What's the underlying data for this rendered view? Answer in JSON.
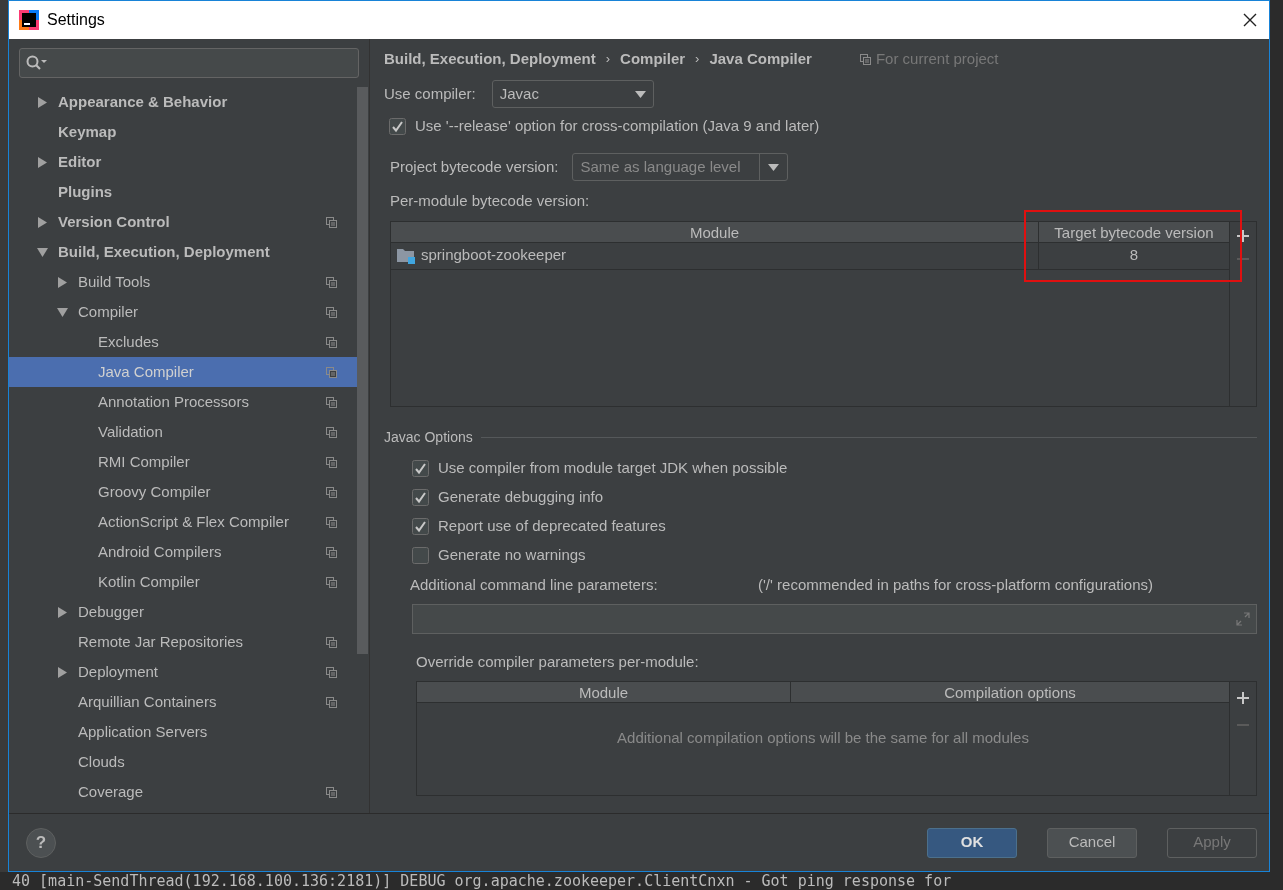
{
  "window": {
    "title": "Settings"
  },
  "sidebar": {
    "items": [
      {
        "label": "Appearance & Behavior",
        "expanded": false,
        "project_level": false,
        "selected": false
      },
      {
        "label": "Keymap",
        "project_level": false,
        "selected": false
      },
      {
        "label": "Editor",
        "expanded": false,
        "project_level": false,
        "selected": false
      },
      {
        "label": "Plugins",
        "project_level": false,
        "selected": false
      },
      {
        "label": "Version Control",
        "expanded": false,
        "project_level": true,
        "selected": false
      },
      {
        "label": "Build, Execution, Deployment",
        "expanded": true,
        "project_level": false,
        "selected": false,
        "children": [
          {
            "label": "Build Tools",
            "expanded": false,
            "project_level": true,
            "selected": false
          },
          {
            "label": "Compiler",
            "expanded": true,
            "project_level": true,
            "selected": false,
            "children": [
              {
                "label": "Excludes",
                "project_level": true,
                "selected": false
              },
              {
                "label": "Java Compiler",
                "project_level": true,
                "selected": true
              },
              {
                "label": "Annotation Processors",
                "project_level": true,
                "selected": false
              },
              {
                "label": "Validation",
                "project_level": true,
                "selected": false
              },
              {
                "label": "RMI Compiler",
                "project_level": true,
                "selected": false
              },
              {
                "label": "Groovy Compiler",
                "project_level": true,
                "selected": false
              },
              {
                "label": "ActionScript & Flex Compiler",
                "project_level": true,
                "selected": false
              },
              {
                "label": "Android Compilers",
                "project_level": true,
                "selected": false
              },
              {
                "label": "Kotlin Compiler",
                "project_level": true,
                "selected": false
              }
            ]
          },
          {
            "label": "Debugger",
            "expanded": false,
            "project_level": false,
            "selected": false
          },
          {
            "label": "Remote Jar Repositories",
            "project_level": true,
            "selected": false
          },
          {
            "label": "Deployment",
            "expanded": false,
            "project_level": true,
            "selected": false
          },
          {
            "label": "Arquillian Containers",
            "project_level": true,
            "selected": false
          },
          {
            "label": "Application Servers",
            "project_level": false,
            "selected": false
          },
          {
            "label": "Clouds",
            "project_level": false,
            "selected": false
          },
          {
            "label": "Coverage",
            "project_level": true,
            "selected": false
          }
        ]
      }
    ]
  },
  "breadcrumb": [
    "Build, Execution, Deployment",
    "Compiler",
    "Java Compiler"
  ],
  "breadcrumb_separator": "›",
  "scope_note": "For current project",
  "use_compiler": {
    "label": "Use compiler:",
    "value": "Javac"
  },
  "release_option": {
    "label": "Use '--release' option for cross-compilation (Java 9 and later)",
    "checked": true
  },
  "project_bytecode": {
    "label": "Project bytecode version:",
    "value": "Same as language level",
    "disabled": true
  },
  "per_module": {
    "label": "Per-module bytecode version:",
    "columns": [
      "Module",
      "Target bytecode version"
    ],
    "rows": [
      {
        "module": "springboot-zookeeper",
        "target": "8"
      }
    ],
    "highlighted": true
  },
  "javac_options": {
    "title": "Javac Options",
    "options": [
      {
        "label": "Use compiler from module target JDK when possible",
        "checked": true
      },
      {
        "label": "Generate debugging info",
        "checked": true
      },
      {
        "label": "Report use of deprecated features",
        "checked": true
      },
      {
        "label": "Generate no warnings",
        "checked": false
      }
    ],
    "params_label": "Additional command line parameters:",
    "params_hint": "('/' recommended in paths for cross-platform configurations)",
    "override_label": "Override compiler parameters per-module:",
    "override_columns": [
      "Module",
      "Compilation options"
    ],
    "override_empty": "Additional compilation options will be the same for all modules"
  },
  "buttons": [
    {
      "label": "OK",
      "kind": "primary",
      "disabled": false
    },
    {
      "label": "Cancel",
      "kind": "normal",
      "disabled": false
    },
    {
      "label": "Apply",
      "kind": "normal",
      "disabled": true
    }
  ],
  "help": "?",
  "background_log": "40 [main-SendThread(192.168.100.136:2181)] DEBUG org.apache.zookeeper.ClientCnxn - Got ping response for"
}
